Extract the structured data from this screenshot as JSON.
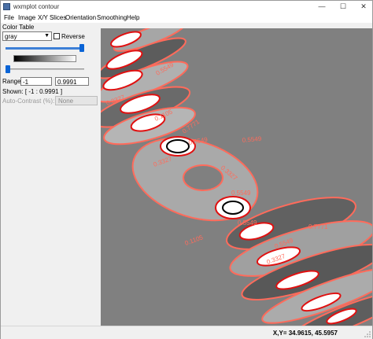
{
  "window": {
    "title": "wxmplot contour"
  },
  "window_controls": {
    "minimize": "—",
    "maximize": "☐",
    "close": "✕"
  },
  "menu": [
    {
      "label": "File"
    },
    {
      "label": "Image"
    },
    {
      "label": "X/Y Slices"
    },
    {
      "label": "Orientation"
    },
    {
      "label": "Smoothing"
    },
    {
      "label": "Help"
    }
  ],
  "panel": {
    "color_table_label": "Color Table",
    "color_table_value": "gray",
    "reverse_label": "Reverse",
    "reverse_checked": false,
    "upper_slider_level": 1.0,
    "lower_slider_level": 0.0,
    "range_label": "Range:",
    "range_min": "-1",
    "range_max": "0.9991",
    "shown_text": "Shown: [ -1 :  0.9991 ]",
    "auto_contrast_label": "Auto-Contrast (%):",
    "auto_contrast_value": "None"
  },
  "plot": {
    "background": "#808080",
    "contour_colors": [
      "#ff0000",
      "#ff6b5b",
      "#ffffff",
      "#000000",
      "#a0a0a0"
    ],
    "contour_labels": [
      "0.5549",
      "0.3327",
      "0.1105",
      "0.7771",
      "0.5549",
      "0.3327",
      "0.5549",
      "0.3327",
      "0.5549",
      "0.5549",
      "0.1105",
      "0.7771",
      "0.5549",
      "0.3327"
    ]
  },
  "status": {
    "coords": "X,Y= 34.9615, 45.5957"
  }
}
